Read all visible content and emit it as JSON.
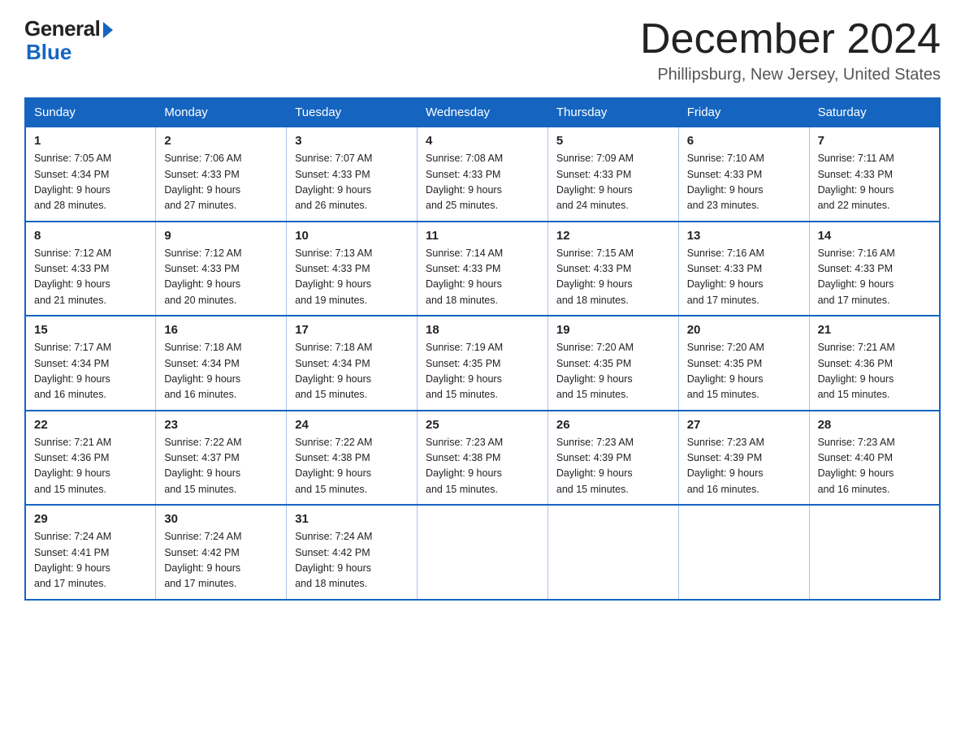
{
  "header": {
    "logo_general": "General",
    "logo_blue": "Blue",
    "month_title": "December 2024",
    "location": "Phillipsburg, New Jersey, United States"
  },
  "days_of_week": [
    "Sunday",
    "Monday",
    "Tuesday",
    "Wednesday",
    "Thursday",
    "Friday",
    "Saturday"
  ],
  "weeks": [
    [
      {
        "day": "1",
        "sunrise": "7:05 AM",
        "sunset": "4:34 PM",
        "daylight": "9 hours and 28 minutes."
      },
      {
        "day": "2",
        "sunrise": "7:06 AM",
        "sunset": "4:33 PM",
        "daylight": "9 hours and 27 minutes."
      },
      {
        "day": "3",
        "sunrise": "7:07 AM",
        "sunset": "4:33 PM",
        "daylight": "9 hours and 26 minutes."
      },
      {
        "day": "4",
        "sunrise": "7:08 AM",
        "sunset": "4:33 PM",
        "daylight": "9 hours and 25 minutes."
      },
      {
        "day": "5",
        "sunrise": "7:09 AM",
        "sunset": "4:33 PM",
        "daylight": "9 hours and 24 minutes."
      },
      {
        "day": "6",
        "sunrise": "7:10 AM",
        "sunset": "4:33 PM",
        "daylight": "9 hours and 23 minutes."
      },
      {
        "day": "7",
        "sunrise": "7:11 AM",
        "sunset": "4:33 PM",
        "daylight": "9 hours and 22 minutes."
      }
    ],
    [
      {
        "day": "8",
        "sunrise": "7:12 AM",
        "sunset": "4:33 PM",
        "daylight": "9 hours and 21 minutes."
      },
      {
        "day": "9",
        "sunrise": "7:12 AM",
        "sunset": "4:33 PM",
        "daylight": "9 hours and 20 minutes."
      },
      {
        "day": "10",
        "sunrise": "7:13 AM",
        "sunset": "4:33 PM",
        "daylight": "9 hours and 19 minutes."
      },
      {
        "day": "11",
        "sunrise": "7:14 AM",
        "sunset": "4:33 PM",
        "daylight": "9 hours and 18 minutes."
      },
      {
        "day": "12",
        "sunrise": "7:15 AM",
        "sunset": "4:33 PM",
        "daylight": "9 hours and 18 minutes."
      },
      {
        "day": "13",
        "sunrise": "7:16 AM",
        "sunset": "4:33 PM",
        "daylight": "9 hours and 17 minutes."
      },
      {
        "day": "14",
        "sunrise": "7:16 AM",
        "sunset": "4:33 PM",
        "daylight": "9 hours and 17 minutes."
      }
    ],
    [
      {
        "day": "15",
        "sunrise": "7:17 AM",
        "sunset": "4:34 PM",
        "daylight": "9 hours and 16 minutes."
      },
      {
        "day": "16",
        "sunrise": "7:18 AM",
        "sunset": "4:34 PM",
        "daylight": "9 hours and 16 minutes."
      },
      {
        "day": "17",
        "sunrise": "7:18 AM",
        "sunset": "4:34 PM",
        "daylight": "9 hours and 15 minutes."
      },
      {
        "day": "18",
        "sunrise": "7:19 AM",
        "sunset": "4:35 PM",
        "daylight": "9 hours and 15 minutes."
      },
      {
        "day": "19",
        "sunrise": "7:20 AM",
        "sunset": "4:35 PM",
        "daylight": "9 hours and 15 minutes."
      },
      {
        "day": "20",
        "sunrise": "7:20 AM",
        "sunset": "4:35 PM",
        "daylight": "9 hours and 15 minutes."
      },
      {
        "day": "21",
        "sunrise": "7:21 AM",
        "sunset": "4:36 PM",
        "daylight": "9 hours and 15 minutes."
      }
    ],
    [
      {
        "day": "22",
        "sunrise": "7:21 AM",
        "sunset": "4:36 PM",
        "daylight": "9 hours and 15 minutes."
      },
      {
        "day": "23",
        "sunrise": "7:22 AM",
        "sunset": "4:37 PM",
        "daylight": "9 hours and 15 minutes."
      },
      {
        "day": "24",
        "sunrise": "7:22 AM",
        "sunset": "4:38 PM",
        "daylight": "9 hours and 15 minutes."
      },
      {
        "day": "25",
        "sunrise": "7:23 AM",
        "sunset": "4:38 PM",
        "daylight": "9 hours and 15 minutes."
      },
      {
        "day": "26",
        "sunrise": "7:23 AM",
        "sunset": "4:39 PM",
        "daylight": "9 hours and 15 minutes."
      },
      {
        "day": "27",
        "sunrise": "7:23 AM",
        "sunset": "4:39 PM",
        "daylight": "9 hours and 16 minutes."
      },
      {
        "day": "28",
        "sunrise": "7:23 AM",
        "sunset": "4:40 PM",
        "daylight": "9 hours and 16 minutes."
      }
    ],
    [
      {
        "day": "29",
        "sunrise": "7:24 AM",
        "sunset": "4:41 PM",
        "daylight": "9 hours and 17 minutes."
      },
      {
        "day": "30",
        "sunrise": "7:24 AM",
        "sunset": "4:42 PM",
        "daylight": "9 hours and 17 minutes."
      },
      {
        "day": "31",
        "sunrise": "7:24 AM",
        "sunset": "4:42 PM",
        "daylight": "9 hours and 18 minutes."
      },
      null,
      null,
      null,
      null
    ]
  ],
  "labels": {
    "sunrise": "Sunrise:",
    "sunset": "Sunset:",
    "daylight": "Daylight:"
  }
}
